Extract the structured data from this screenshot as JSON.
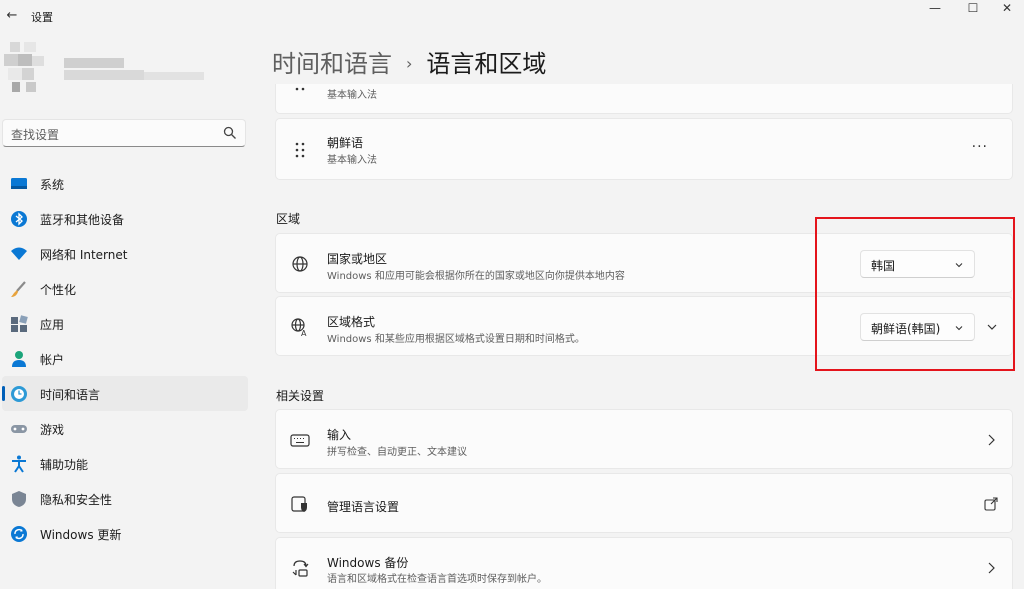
{
  "window": {
    "title": "设置",
    "back_glyph": "←",
    "min_glyph": "—",
    "max_glyph": "☐",
    "close_glyph": "✕"
  },
  "search": {
    "placeholder": "查找设置"
  },
  "nav": {
    "items": [
      {
        "label": "系统",
        "icon": "system-icon"
      },
      {
        "label": "蓝牙和其他设备",
        "icon": "bluetooth-icon"
      },
      {
        "label": "网络和 Internet",
        "icon": "wifi-icon"
      },
      {
        "label": "个性化",
        "icon": "brush-icon"
      },
      {
        "label": "应用",
        "icon": "apps-icon"
      },
      {
        "label": "帐户",
        "icon": "account-icon"
      },
      {
        "label": "时间和语言",
        "icon": "time-language-icon",
        "active": true
      },
      {
        "label": "游戏",
        "icon": "gaming-icon"
      },
      {
        "label": "辅助功能",
        "icon": "accessibility-icon"
      },
      {
        "label": "隐私和安全性",
        "icon": "shield-icon"
      },
      {
        "label": "Windows 更新",
        "icon": "update-icon"
      }
    ]
  },
  "breadcrumb": {
    "parent": "时间和语言",
    "separator": "›",
    "current": "语言和区域"
  },
  "keyboards": [
    {
      "title": "",
      "subtitle": "基本输入法"
    },
    {
      "title": "朝鲜语",
      "subtitle": "基本输入法",
      "more": "···"
    }
  ],
  "region": {
    "heading": "区域",
    "country": {
      "title": "国家或地区",
      "subtitle": "Windows 和应用可能会根据你所在的国家或地区向你提供本地内容",
      "value": "韩国"
    },
    "format": {
      "title": "区域格式",
      "subtitle": "Windows 和某些应用根据区域格式设置日期和时间格式。",
      "value": "朝鲜语(韩国)"
    }
  },
  "related": {
    "heading": "相关设置",
    "items": [
      {
        "title": "输入",
        "subtitle": "拼写检查、自动更正、文本建议"
      },
      {
        "title": "管理语言设置",
        "subtitle": ""
      },
      {
        "title": "Windows 备份",
        "subtitle": "语言和区域格式在检查语言首选项时保存到帐户。"
      }
    ]
  },
  "colors": {
    "accent": "#005fb8",
    "highlight": "#e4141b"
  }
}
